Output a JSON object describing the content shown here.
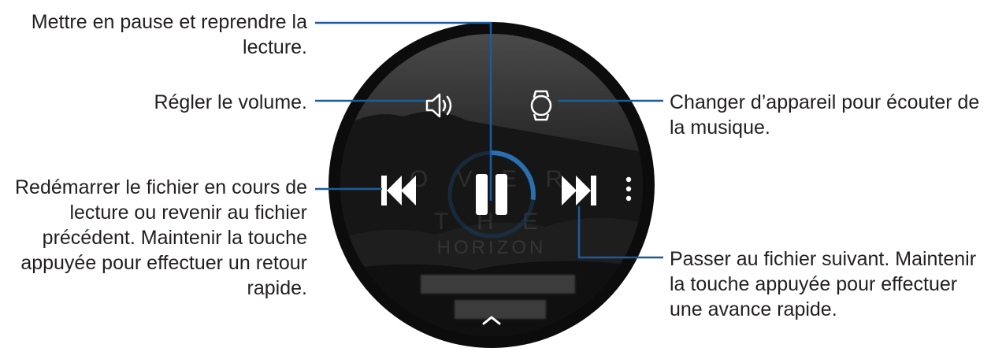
{
  "callouts": {
    "pause": {
      "lines": [
        "Mettre en pause et reprendre la",
        "lecture."
      ]
    },
    "volume": {
      "lines": [
        "Régler le volume."
      ]
    },
    "previous": {
      "lines": [
        "Redémarrer le fichier en cours de",
        "lecture ou revenir au fichier",
        "précédent. Maintenir la touche",
        "appuyée pour effectuer un retour",
        "rapide."
      ]
    },
    "device": {
      "lines": [
        "Changer d’appareil pour écouter de",
        "la musique."
      ]
    },
    "next": {
      "lines": [
        "Passer au fichier suivant. Maintenir",
        "la touche appuyée pour effectuer",
        "une avance rapide."
      ]
    }
  },
  "watch_screen": {
    "album_art_lines": [
      "O V E R",
      "T H E",
      "HORIZON"
    ],
    "icons": {
      "volume": "speaker-icon",
      "device": "watch-icon",
      "previous": "skip-previous-icon",
      "play_pause": "pause-icon",
      "next": "skip-next-icon",
      "more": "more-vertical-icon",
      "expand": "chevron-up-icon"
    },
    "playback_progress": 0.27,
    "colors": {
      "progress_ring": "#2a6fb0",
      "controls": "#ffffff",
      "callout_line": "#1c5c9a"
    }
  }
}
